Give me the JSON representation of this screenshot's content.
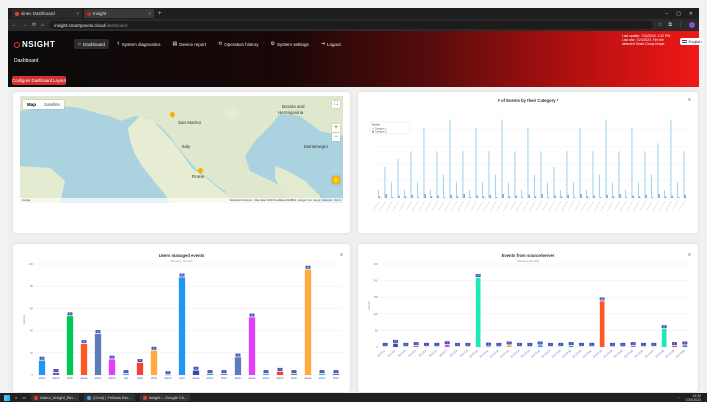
{
  "browser": {
    "tabs": [
      {
        "label": "sinec Dashboard"
      },
      {
        "label": "Insight"
      }
    ],
    "url_host": "insight.smartpanels.cloud",
    "url_path": "/dashboard"
  },
  "app": {
    "logo": "NSIGHT",
    "nav": [
      {
        "label": "Dashboard",
        "icon": "home-icon"
      },
      {
        "label": "System diagnostics",
        "icon": "diagnostics-icon"
      },
      {
        "label": "Device report",
        "icon": "report-icon"
      },
      {
        "label": "Operation history",
        "icon": "history-icon"
      },
      {
        "label": "System settings",
        "icon": "gear-icon"
      },
      {
        "label": "Logout",
        "icon": "logout-icon"
      }
    ],
    "notice": "Last update: 7/24/2023, 1:32 PM. Last use: 7/24/2023. Fire the detected Smart Group helper.",
    "language": "English",
    "page_title": "Dashboard",
    "configure_button": "Configure Dashboard Layout"
  },
  "map": {
    "tabs": [
      "Map",
      "Satellite"
    ],
    "labels": [
      {
        "text": "Bosnia and",
        "cls": "l1"
      },
      {
        "text": "Herzegovina",
        "cls": "l2"
      },
      {
        "text": "San Marino",
        "cls": "l3"
      },
      {
        "text": "Italy",
        "cls": "l4"
      },
      {
        "text": "Montenegro",
        "cls": "l5"
      },
      {
        "text": "Rome",
        "cls": "l6"
      }
    ],
    "footer_left": "Google",
    "footer_right": "Keyboard shortcuts · Map data ©2023 GeoBasis-DE/BKG, Google, Inst. Geogr. Nacional · Terms"
  },
  "chart_data": [
    {
      "type": "bar",
      "title": "# of Events by their Category *",
      "subtitle": "",
      "legend": {
        "title": "Device",
        "entries": [
          "Category 1",
          "Category 2"
        ],
        "placement": "top-left"
      },
      "series": [
        {
          "name": "Category 1",
          "color": "#9bd3ef",
          "values": [
            0.1,
            0.4,
            0.2,
            0.5,
            0.1,
            0.6,
            0.2,
            0.9,
            0.1,
            0.6,
            0.3,
            1.0,
            0.2,
            0.6,
            0.1,
            0.9,
            0.2,
            0.6,
            0.3,
            1.0,
            0.2,
            0.6,
            0.1,
            0.9,
            0.3,
            0.6,
            0.2,
            0.4,
            0.1,
            0.6,
            0.2,
            0.9,
            0.1,
            0.6,
            0.3,
            1.0,
            0.2,
            0.6,
            0.1,
            0.9,
            0.2,
            0.6,
            0.3,
            0.7,
            0.1,
            1.0,
            0.2,
            0.6
          ]
        },
        {
          "name": "Category 2",
          "color": "#5e6fc7",
          "values": [
            0.02,
            0.05,
            0.01,
            0.03,
            0.02,
            0.04,
            0.01,
            0.05,
            0.02,
            0.03,
            0.01,
            0.04,
            0.02,
            0.05,
            0.01,
            0.03,
            0.02,
            0.04,
            0.01,
            0.05,
            0.02,
            0.03,
            0.01,
            0.04,
            0.02,
            0.05,
            0.01,
            0.03,
            0.02,
            0.04,
            0.01,
            0.05,
            0.02,
            0.03,
            0.01,
            0.04,
            0.02,
            0.05,
            0.01,
            0.03,
            0.02,
            0.04,
            0.01,
            0.05,
            0.02,
            0.03,
            0.01,
            0.04
          ]
        }
      ],
      "ylim": [
        0,
        1.1
      ],
      "grid": true
    },
    {
      "type": "bar",
      "title": "Users managed events",
      "subtitle": "Showing all data",
      "categories": [
        "admin",
        "admin",
        "thwin",
        "admin",
        "admin",
        "admin",
        "test",
        "thwin",
        "thwin",
        "admin",
        "User",
        "admin",
        "Admin",
        "thwin",
        "admin",
        "admin",
        "admin",
        "admin",
        "thwin",
        "admin",
        "admin",
        "thwin"
      ],
      "values": [
        13,
        2,
        53,
        28,
        37,
        14,
        1,
        11,
        22,
        0,
        88,
        4,
        1,
        1,
        16,
        52,
        1,
        3,
        1,
        95,
        1,
        1
      ],
      "colors": [
        "#2196f3",
        "#7e57c2",
        "#00c853",
        "#ff5722",
        "#5c7cbb",
        "#e040fb",
        "#29b6f6",
        "#f44336",
        "#ffab40",
        "#26c6da",
        "#2196f3",
        "#3949ab",
        "#26a69a",
        "#78909c",
        "#5c7cbb",
        "#e040fb",
        "#29b6f6",
        "#f44336",
        "#43a047",
        "#ffab40",
        "#26c6da",
        "#5c6bc0"
      ],
      "ylim": [
        0,
        100
      ],
      "ylabel": "Events",
      "grid": true
    },
    {
      "type": "bar",
      "title": "Events from source/server",
      "subtitle": "Showing all data",
      "categories": [
        "10.2.0.1",
        "10.2.0.2",
        "10.2.0.3",
        "10.2.0.4",
        "10.2.0.5",
        "10.2.0.6",
        "10.2.0.7",
        "10.2.0.8",
        "10.2.0.9",
        "10.2.0.10",
        "10.2.0.11",
        "10.2.0.12",
        "10.2.0.13",
        "10.2.0.14",
        "10.2.0.15",
        "10.2.0.16",
        "10.2.0.17",
        "10.2.0.18",
        "10.2.0.19",
        "10.2.0.20",
        "10.2.0.21",
        "10.2.0.22",
        "10.2.0.23",
        "10.2.0.24",
        "10.2.0.25",
        "10.2.0.26",
        "10.2.0.27",
        "10.2.0.28",
        "10.2.0.29",
        "10.2.0.30"
      ],
      "values": [
        1,
        12,
        1,
        4,
        1,
        1,
        7,
        1,
        1,
        250,
        2,
        1,
        6,
        1,
        1,
        6,
        1,
        1,
        4,
        1,
        1,
        165,
        1,
        1,
        4,
        1,
        1,
        65,
        4,
        6
      ],
      "colors": [
        "#9575cd",
        "#3949ab",
        "#26a69a",
        "#ff5722",
        "#ffab40",
        "#5c7cbb",
        "#e040fb",
        "#29b6f6",
        "#f44336",
        "#1de9b6",
        "#7e57c2",
        "#3949ab",
        "#ffab40",
        "#26c6da",
        "#5c6bc0",
        "#2196f3",
        "#e040fb",
        "#29b6f6",
        "#00c853",
        "#ffab40",
        "#26c6da",
        "#ff5722",
        "#7e57c2",
        "#3949ab",
        "#e040fb",
        "#29b6f6",
        "#ffab40",
        "#1de9b6",
        "#f44336",
        "#5c7cbb"
      ],
      "ylim": [
        0,
        300
      ],
      "ylabel": "Events",
      "grid": true
    }
  ],
  "taskbar": {
    "apps": [
      {
        "label": "Attero_Insight_Bin...",
        "dot": "red"
      },
      {
        "label": "(Chat) | Fellows Bro...",
        "dot": "blue"
      },
      {
        "label": "Insight – Google Ch...",
        "dot": "red"
      }
    ],
    "time": "13:32",
    "date": "7/24/2023"
  }
}
